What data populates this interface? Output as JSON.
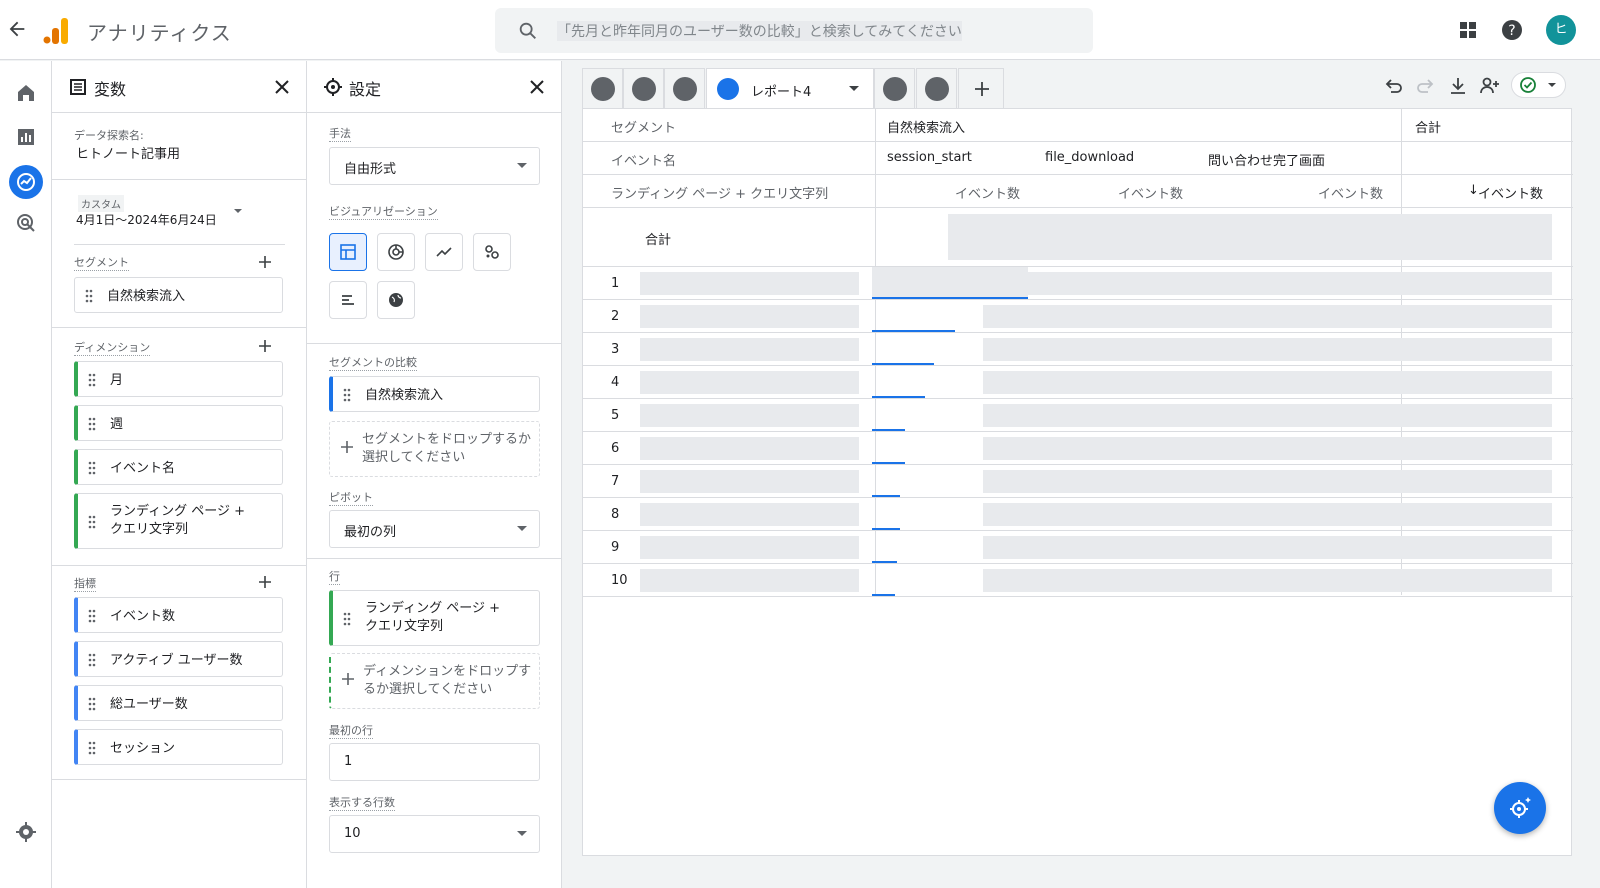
{
  "app": {
    "title": "アナリティクス"
  },
  "search": {
    "placeholder": "「先月と昨年同月のユーザー数の比較」と検索してみてください"
  },
  "user": {
    "initial": "ヒ"
  },
  "colors": {
    "accent": "#1a73e8",
    "dimension": "#34a853",
    "metric": "#4285f4",
    "avatar": "#12939a"
  },
  "variables": {
    "title": "変数",
    "exploration_label": "データ探索名:",
    "exploration_name": "ヒトノート記事用",
    "date_label": "カスタム",
    "date_range": "4月1日～2024年6月24日",
    "segments_label": "セグメント",
    "segments": [
      "自然検索流入"
    ],
    "dimensions_label": "ディメンション",
    "dimensions": [
      "月",
      "週",
      "イベント名",
      "ランディング ページ + クエリ文字列"
    ],
    "metrics_label": "指標",
    "metrics": [
      "イベント数",
      "アクティブ ユーザー数",
      "総ユーザー数",
      "セッション"
    ]
  },
  "settings": {
    "title": "設定",
    "technique_label": "手法",
    "technique_value": "自由形式",
    "viz_label": "ビジュアリゼーション",
    "segment_compare_label": "セグメントの比較",
    "segment_compare": "自然検索流入",
    "segment_drop": "セグメントをドロップするか選択してください",
    "pivot_label": "ピボット",
    "pivot_value": "最初の列",
    "rows_label": "行",
    "rows_dimension": "ランディング ページ + クエリ文字列",
    "rows_drop": "ディメンションをドロップするか選択してください",
    "first_row_label": "最初の行",
    "first_row_value": "1",
    "show_rows_label": "表示する行数",
    "show_rows_value": "10"
  },
  "report": {
    "tab_label": "レポート4",
    "header": {
      "segment_label": "セグメント",
      "segment_value": "自然検索流入",
      "total_label": "合計",
      "event_name_label": "イベント名",
      "events": [
        "session_start",
        "file_download",
        "問い合わせ完了画面"
      ],
      "landing_label": "ランディング ページ + クエリ文字列",
      "metric": "イベント数",
      "sorted_metric": "イベント数"
    },
    "total_row": "合計",
    "rows": [
      {
        "n": "1",
        "fill": 1.0
      },
      {
        "n": "2",
        "fill": 0.53
      },
      {
        "n": "3",
        "fill": 0.4
      },
      {
        "n": "4",
        "fill": 0.34
      },
      {
        "n": "5",
        "fill": 0.21
      },
      {
        "n": "6",
        "fill": 0.21
      },
      {
        "n": "7",
        "fill": 0.18
      },
      {
        "n": "8",
        "fill": 0.18
      },
      {
        "n": "9",
        "fill": 0.16
      },
      {
        "n": "10",
        "fill": 0.15
      }
    ]
  }
}
